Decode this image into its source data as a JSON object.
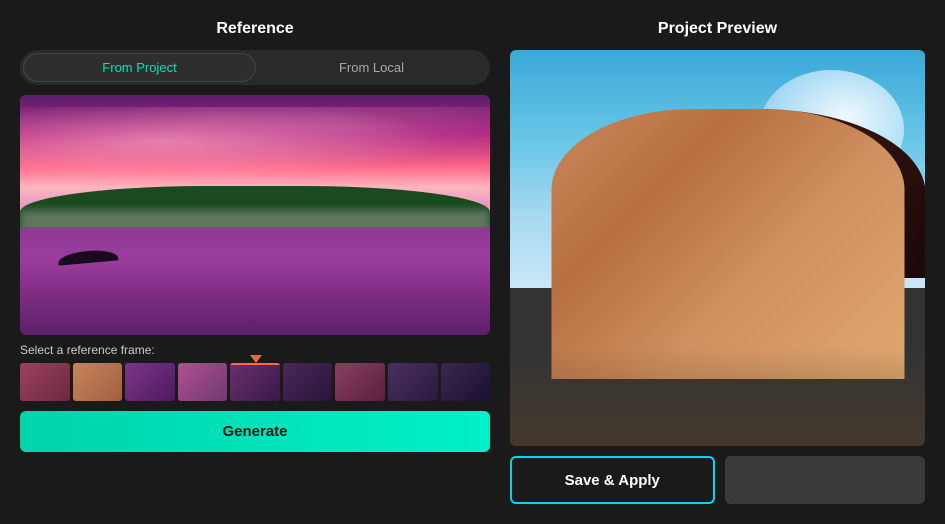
{
  "left_panel": {
    "title": "Reference",
    "tab_from_project": "From Project",
    "tab_from_local": "From Local",
    "active_tab": "from_project",
    "frame_label": "Select a reference frame:",
    "generate_label": "Generate"
  },
  "right_panel": {
    "title": "Project Preview",
    "save_apply_label": "Save & Apply",
    "export_label": ""
  },
  "filmstrip": {
    "thumbs": [
      {
        "style": "thumb-warm"
      },
      {
        "style": "thumb-face"
      },
      {
        "style": "thumb-purple"
      },
      {
        "style": "thumb-pink-sky"
      },
      {
        "style": "thumb-purple2",
        "active": true
      },
      {
        "style": "thumb-dark-purple"
      },
      {
        "style": "thumb-dusk"
      },
      {
        "style": "thumb-evening"
      },
      {
        "style": "thumb-night"
      }
    ]
  }
}
